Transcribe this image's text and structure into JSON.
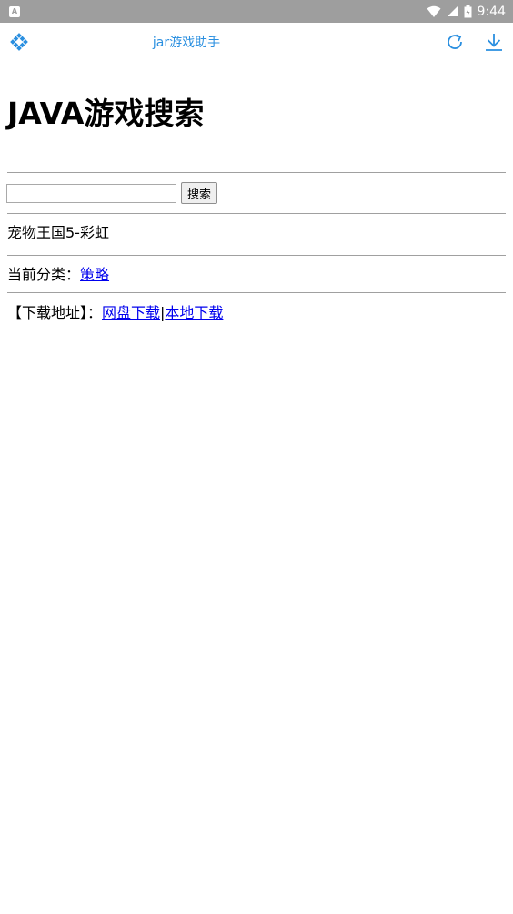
{
  "status_bar": {
    "time": "9:44",
    "notification_icon_letter": "A"
  },
  "app_bar": {
    "title": "jar游戏助手"
  },
  "page": {
    "heading": "JAVA游戏搜索",
    "search": {
      "input_value": "",
      "button_label": "搜索"
    },
    "game_name": "宠物王国5-彩虹",
    "category": {
      "label": "当前分类：",
      "value": "策略"
    },
    "download": {
      "label": "【下载地址】：",
      "links": [
        {
          "label": "网盘下载"
        },
        {
          "label": "本地下载"
        }
      ],
      "separator": "|"
    }
  },
  "colors": {
    "status_bar": "#9e9e9e",
    "accent": "#2a8fe0",
    "link": "#0000ee"
  }
}
